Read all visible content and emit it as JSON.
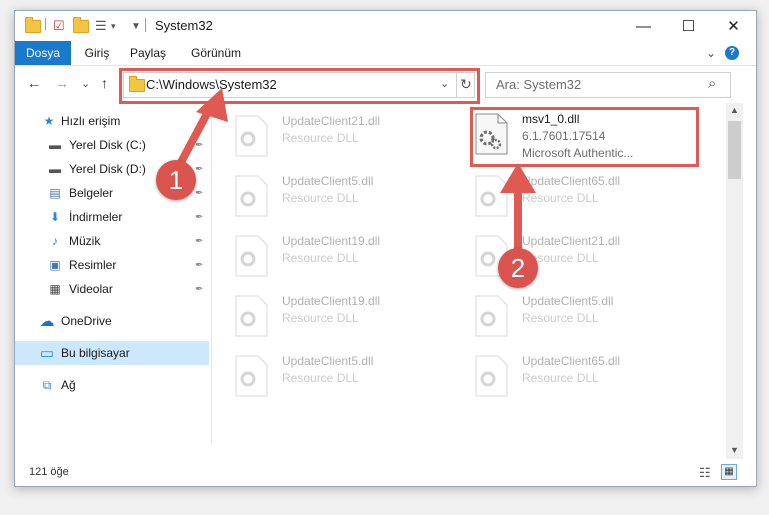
{
  "window": {
    "title": "System32",
    "controls": {
      "minimize": "—",
      "maximize": "☐",
      "close": "✕"
    }
  },
  "ribbon": {
    "tabs": [
      "Dosya",
      "Giriş",
      "Paylaş",
      "Görünüm"
    ],
    "active_tab": "Dosya",
    "expand_icon": "⌄",
    "help_icon": "?"
  },
  "navigation": {
    "back": "←",
    "forward": "→",
    "recent": "⌄",
    "up": "↑",
    "address": "C:\\Windows\\System32",
    "refresh": "↻",
    "search_placeholder": "Ara: System32",
    "search_icon": "⌕"
  },
  "sidebar": {
    "items": [
      {
        "label": "Hızlı erişim",
        "icon": "star-icon",
        "glyph": "★",
        "color": "#2b8ad8",
        "pinned": false
      },
      {
        "label": "Yerel Disk (C:)",
        "icon": "drive-icon",
        "glyph": "▬",
        "color": "#555555",
        "pinned": true
      },
      {
        "label": "Yerel Disk (D:)",
        "icon": "drive-icon",
        "glyph": "▬",
        "color": "#555555",
        "pinned": true
      },
      {
        "label": "Belgeler",
        "icon": "documents-icon",
        "glyph": "▤",
        "color": "#4a6fa5",
        "pinned": true
      },
      {
        "label": "İndirmeler",
        "icon": "downloads-icon",
        "glyph": "⬇",
        "color": "#2b8ad8",
        "pinned": true
      },
      {
        "label": "Müzik",
        "icon": "music-icon",
        "glyph": "♪",
        "color": "#2b8ad8",
        "pinned": true
      },
      {
        "label": "Resimler",
        "icon": "pictures-icon",
        "glyph": "▣",
        "color": "#3d7ab8",
        "pinned": true
      },
      {
        "label": "Videolar",
        "icon": "videos-icon",
        "glyph": "▦",
        "color": "#444444",
        "pinned": true
      },
      {
        "label": "OneDrive",
        "icon": "cloud-icon",
        "glyph": "☁",
        "color": "#1e73c8",
        "pinned": false
      },
      {
        "label": "Bu bilgisayar",
        "icon": "computer-icon",
        "glyph": "▭",
        "color": "#2b8ad8",
        "pinned": false
      },
      {
        "label": "Ağ",
        "icon": "network-icon",
        "glyph": "⧉",
        "color": "#2b8ad8",
        "pinned": false
      }
    ],
    "pin_glyph": "📌",
    "selected": "Bu bilgisayar"
  },
  "files": {
    "left_column": [
      {
        "name": "UpdateClient21.dll",
        "type": "Resource DLL"
      },
      {
        "name": "UpdateClient5.dll",
        "type": "Resource DLL"
      },
      {
        "name": "UpdateClient19.dll",
        "type": "Resource DLL"
      },
      {
        "name": "UpdateClient19.dll",
        "type": "Resource DLL"
      },
      {
        "name": "UpdateClient5.dll",
        "type": "Resource DLL"
      }
    ],
    "highlighted": {
      "name": "msv1_0.dll",
      "version": "6.1.7601.17514",
      "company": "Microsoft Authentic..."
    },
    "right_column": [
      {
        "name": "UpdateClient65.dll",
        "type": "Resource DLL"
      },
      {
        "name": "UpdateClient21.dll",
        "type": "Resource DLL"
      },
      {
        "name": "UpdateClient5.dll",
        "type": "Resource DLL"
      },
      {
        "name": "UpdateClient65.dll",
        "type": "Resource DLL"
      }
    ]
  },
  "status": {
    "item_count": "121 öğe"
  },
  "annotations": {
    "badge1": "1",
    "badge2": "2",
    "highlight_color": "#e05a54"
  }
}
